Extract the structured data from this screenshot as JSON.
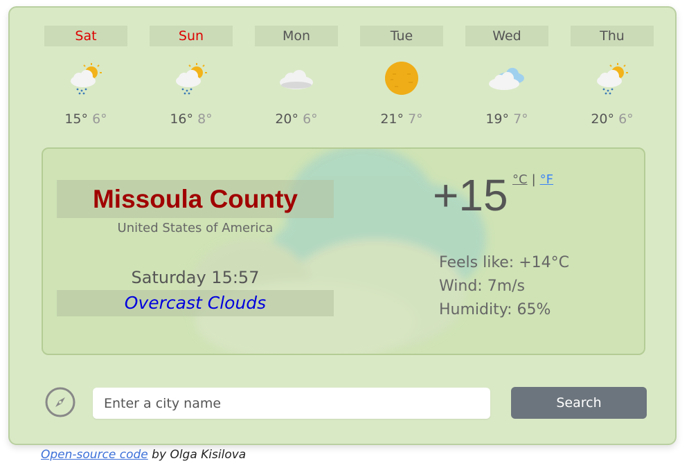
{
  "forecast": [
    {
      "day": "Sat",
      "max": "15°",
      "min": "6°",
      "icon": "sun-rain-icon",
      "weekend": true
    },
    {
      "day": "Sun",
      "max": "16°",
      "min": "8°",
      "icon": "sun-rain-icon",
      "weekend": true
    },
    {
      "day": "Mon",
      "max": "20°",
      "min": "6°",
      "icon": "cloud-icon",
      "weekend": false
    },
    {
      "day": "Tue",
      "max": "21°",
      "min": "7°",
      "icon": "sun-icon",
      "weekend": false
    },
    {
      "day": "Wed",
      "max": "19°",
      "min": "7°",
      "icon": "clouds-icon",
      "weekend": false
    },
    {
      "day": "Thu",
      "max": "20°",
      "min": "6°",
      "icon": "sun-rain-icon",
      "weekend": false
    }
  ],
  "current": {
    "city": "Missoula County",
    "country": "United States of America",
    "datetime": "Saturday 15:57",
    "description": "Overcast Clouds",
    "temperature": "+15",
    "unit_c": "°C",
    "unit_sep": "|",
    "unit_f": "°F",
    "feels_like": "Feels like: +14°C",
    "wind": "Wind: 7m/s",
    "humidity": "Humidity: 65%"
  },
  "search": {
    "placeholder": "Enter a city name",
    "button": "Search"
  },
  "footer": {
    "link_text": "Open-source code",
    "author": " by Olga Kisilova"
  },
  "colors": {
    "panel_bg": "#d9e9c5",
    "city": "#a00000",
    "description": "#0000dd",
    "weekend": "#dd0000",
    "button": "#6c757d"
  }
}
